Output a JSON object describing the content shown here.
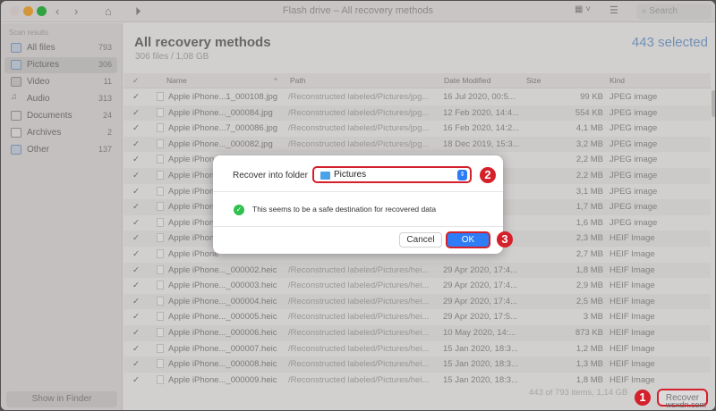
{
  "window": {
    "title": "Flash drive – All recovery methods",
    "search_placeholder": "Search"
  },
  "sidebar": {
    "heading": "Scan results",
    "items": [
      {
        "label": "All files",
        "count": "793"
      },
      {
        "label": "Pictures",
        "count": "306"
      },
      {
        "label": "Video",
        "count": "11"
      },
      {
        "label": "Audio",
        "count": "313"
      },
      {
        "label": "Documents",
        "count": "24"
      },
      {
        "label": "Archives",
        "count": "2"
      },
      {
        "label": "Other",
        "count": "137"
      }
    ],
    "show_in_finder": "Show in Finder"
  },
  "main": {
    "title": "All recovery methods",
    "subtitle": "306 files / 1,08 GB",
    "selected": "443 selected"
  },
  "table": {
    "columns": {
      "name": "Name",
      "path": "Path",
      "date": "Date Modified",
      "size": "Size",
      "kind": "Kind"
    },
    "rows": [
      {
        "name": "Apple iPhone...1_000108.jpg",
        "path": "/Reconstructed labeled/Pictures/jpg...",
        "date": "16 Jul 2020, 00:5...",
        "size": "99 KB",
        "kind": "JPEG image"
      },
      {
        "name": "Apple iPhone..._000084.jpg",
        "path": "/Reconstructed labeled/Pictures/jpg...",
        "date": "12 Feb 2020, 14:4...",
        "size": "554 KB",
        "kind": "JPEG image"
      },
      {
        "name": "Apple iPhone...7_000086.jpg",
        "path": "/Reconstructed labeled/Pictures/jpg...",
        "date": "16 Feb 2020, 14:2...",
        "size": "4,1 MB",
        "kind": "JPEG image"
      },
      {
        "name": "Apple iPhone..._000082.jpg",
        "path": "/Reconstructed labeled/Pictures/jpg...",
        "date": "18 Dec 2019, 15:3...",
        "size": "3,2 MB",
        "kind": "JPEG image"
      },
      {
        "name": "Apple iPhone",
        "path": "",
        "date": "",
        "size": "2,2 MB",
        "kind": "JPEG image"
      },
      {
        "name": "Apple iPhone",
        "path": "",
        "date": "",
        "size": "2,2 MB",
        "kind": "JPEG image"
      },
      {
        "name": "Apple iPhone",
        "path": "",
        "date": "",
        "size": "3,1 MB",
        "kind": "JPEG image"
      },
      {
        "name": "Apple iPhone",
        "path": "",
        "date": "",
        "size": "1,7 MB",
        "kind": "JPEG image"
      },
      {
        "name": "Apple iPhone",
        "path": "",
        "date": "",
        "size": "1,6 MB",
        "kind": "JPEG image"
      },
      {
        "name": "Apple iPhone",
        "path": "",
        "date": "",
        "size": "2,3 MB",
        "kind": "HEIF Image"
      },
      {
        "name": "Apple iPhone",
        "path": "",
        "date": "",
        "size": "2,7 MB",
        "kind": "HEIF Image"
      },
      {
        "name": "Apple iPhone..._000002.heic",
        "path": "/Reconstructed labeled/Pictures/hei...",
        "date": "29 Apr 2020, 17:4...",
        "size": "1,8 MB",
        "kind": "HEIF Image"
      },
      {
        "name": "Apple iPhone..._000003.heic",
        "path": "/Reconstructed labeled/Pictures/hei...",
        "date": "29 Apr 2020, 17:4...",
        "size": "2,9 MB",
        "kind": "HEIF Image"
      },
      {
        "name": "Apple iPhone..._000004.heic",
        "path": "/Reconstructed labeled/Pictures/hei...",
        "date": "29 Apr 2020, 17:4...",
        "size": "2,5 MB",
        "kind": "HEIF Image"
      },
      {
        "name": "Apple iPhone..._000005.heic",
        "path": "/Reconstructed labeled/Pictures/hei...",
        "date": "29 Apr 2020, 17:5...",
        "size": "3 MB",
        "kind": "HEIF Image"
      },
      {
        "name": "Apple iPhone..._000006.heic",
        "path": "/Reconstructed labeled/Pictures/hei...",
        "date": "10 May 2020, 14:...",
        "size": "873 KB",
        "kind": "HEIF Image"
      },
      {
        "name": "Apple iPhone..._000007.heic",
        "path": "/Reconstructed labeled/Pictures/hei...",
        "date": "15 Jan 2020, 18:3...",
        "size": "1,2 MB",
        "kind": "HEIF Image"
      },
      {
        "name": "Apple iPhone..._000008.heic",
        "path": "/Reconstructed labeled/Pictures/hei...",
        "date": "15 Jan 2020, 18:3...",
        "size": "1,3 MB",
        "kind": "HEIF Image"
      },
      {
        "name": "Apple iPhone..._000009.heic",
        "path": "/Reconstructed labeled/Pictures/hei...",
        "date": "15 Jan 2020, 18:3...",
        "size": "1,8 MB",
        "kind": "HEIF Image"
      }
    ]
  },
  "footer": {
    "status": "443 of 793 items, 1,14 GB",
    "recover": "Recover"
  },
  "dialog": {
    "label": "Recover into folder",
    "folder": "Pictures",
    "message": "This seems to be a safe destination for recovered data",
    "cancel": "Cancel",
    "ok": "OK"
  },
  "annotations": {
    "b1": "1",
    "b2": "2",
    "b3": "3"
  },
  "watermark": "wsxdn.com"
}
